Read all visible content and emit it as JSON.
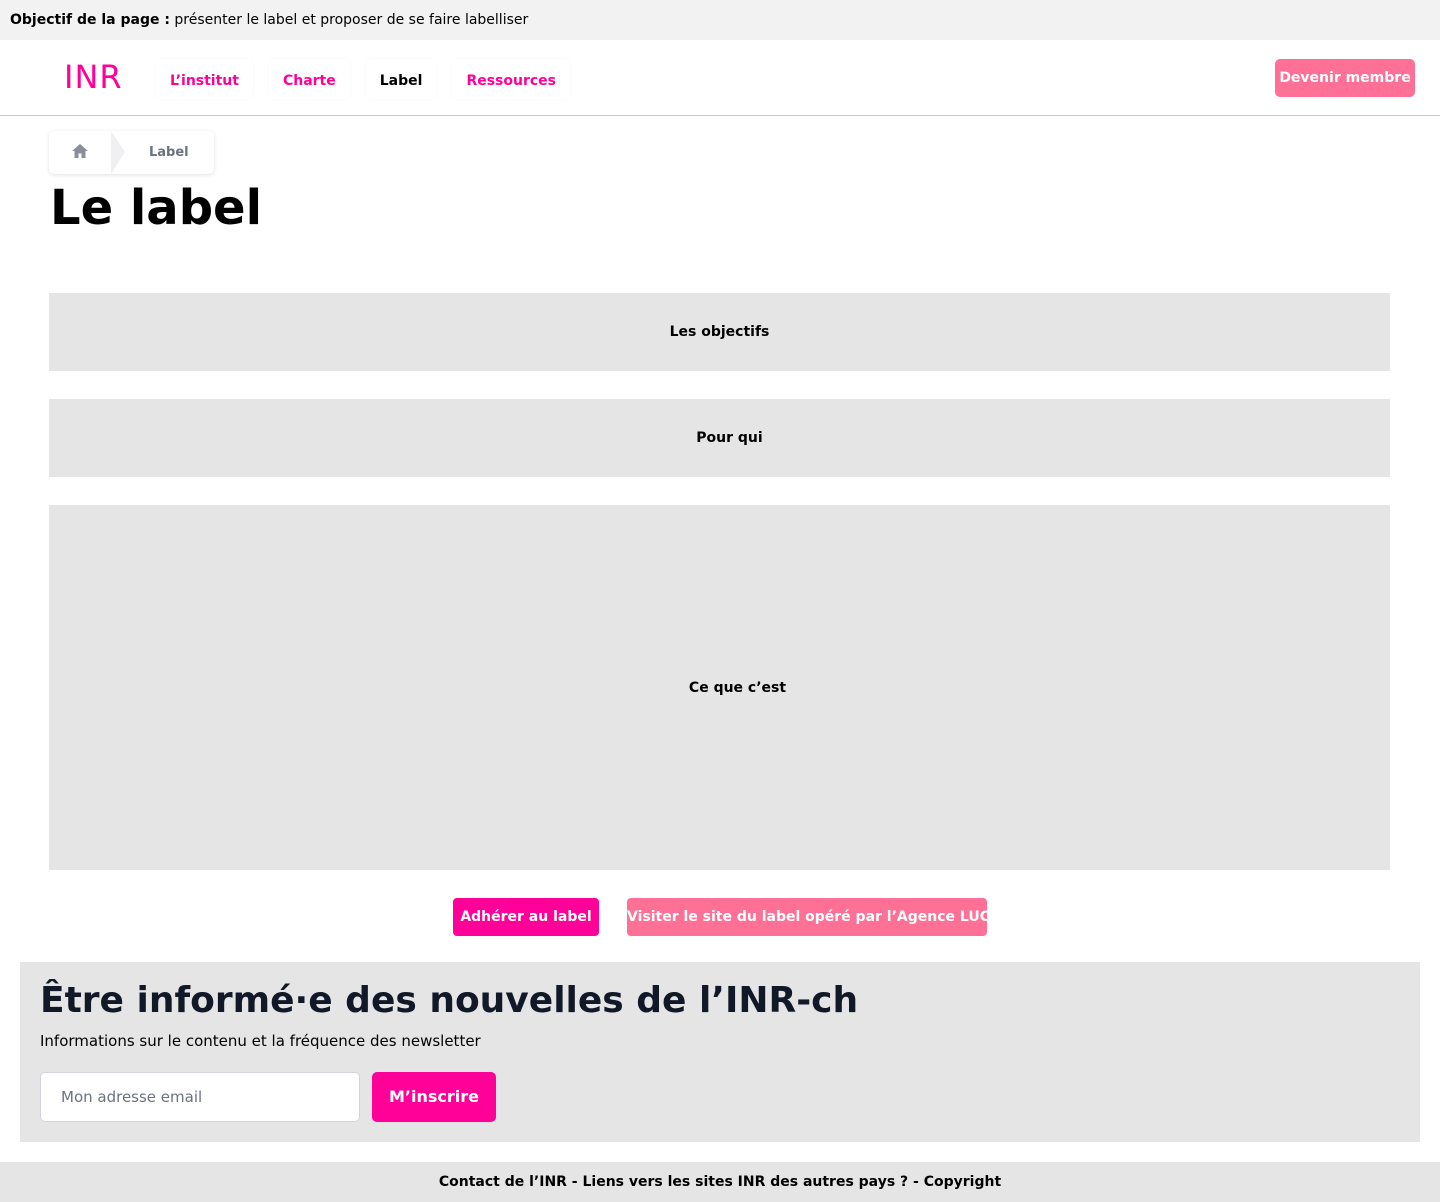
{
  "top_note": {
    "label": "Objectif de la page :",
    "text": "présenter le label et proposer de se faire labelliser"
  },
  "header": {
    "logo": "INR",
    "nav": [
      {
        "label": "L’institut",
        "active": false
      },
      {
        "label": "Charte",
        "active": false
      },
      {
        "label": "Label",
        "active": true
      },
      {
        "label": "Ressources",
        "active": false
      }
    ],
    "cta": "Devenir membre"
  },
  "breadcrumb": {
    "home_icon": "home-icon",
    "current": "Label"
  },
  "page_title": "Le label",
  "sections": [
    {
      "label": "Les objectifs"
    },
    {
      "label": "Pour qui"
    },
    {
      "label": "Ce que c’est"
    }
  ],
  "actions": {
    "primary": "Adhérer au label",
    "secondary": "Visiter le site du label opéré par l’Agence LUCIE"
  },
  "newsletter": {
    "title": "Être informé·e des nouvelles de l’INR-ch",
    "subtitle": "Informations sur le contenu et la fréquence des newsletter",
    "email_placeholder": "Mon adresse email",
    "email_value": "",
    "submit": "M’inscrire"
  },
  "footer": {
    "text": "Contact de l’INR - Liens vers les sites INR des autres pays ? - Copyright"
  },
  "colors": {
    "brand_pink": "#ff0099",
    "light_pink": "#ff7096",
    "panel_grey": "#e5e5e5"
  }
}
